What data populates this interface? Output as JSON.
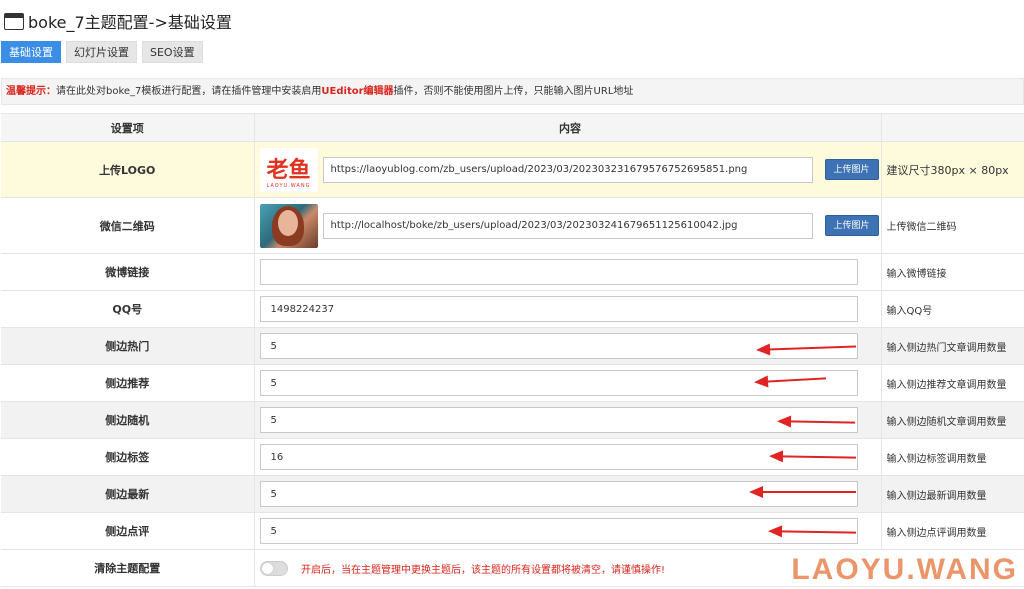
{
  "header": {
    "title": "boke_7主题配置->基础设置",
    "window_icon": "window-icon"
  },
  "tabs": [
    {
      "label": "基础设置",
      "active": true
    },
    {
      "label": "幻灯片设置",
      "active": false
    },
    {
      "label": "SEO设置",
      "active": false
    }
  ],
  "tip": {
    "label": "温馨提示：",
    "text_before": "请在此处对boke_7模板进行配置，请在插件管理中安装启用",
    "strong": "UEditor编辑器",
    "text_after": "插件，否则不能使用图片上传，只能输入图片URL地址"
  },
  "table": {
    "headers": [
      "设置项",
      "内容",
      ""
    ],
    "upload_button_label": "上传图片",
    "rows": {
      "logo": {
        "label": "上传LOGO",
        "value": "https://laoyublog.com/zb_users/upload/2023/03/202303231679576752695851.png",
        "desc": "建议尺寸380px × 80px",
        "thumb_text": "老鱼",
        "thumb_sub": "LAOYU.WANG"
      },
      "wechat": {
        "label": "微信二维码",
        "value": "http://localhost/boke/zb_users/upload/2023/03/202303241679651125610042.jpg",
        "desc": "上传微信二维码"
      },
      "weibo": {
        "label": "微博链接",
        "value": "",
        "desc": "输入微博链接"
      },
      "qq": {
        "label": "QQ号",
        "value": "1498224237",
        "desc": "输入QQ号"
      },
      "hot": {
        "label": "侧边热门",
        "value": "5",
        "desc": "输入侧边热门文章调用数量"
      },
      "recommend": {
        "label": "侧边推荐",
        "value": "5",
        "desc": "输入侧边推荐文章调用数量"
      },
      "random": {
        "label": "侧边随机",
        "value": "5",
        "desc": "输入侧边随机文章调用数量"
      },
      "tags": {
        "label": "侧边标签",
        "value": "16",
        "desc": "输入侧边标签调用数量"
      },
      "latest": {
        "label": "侧边最新",
        "value": "5",
        "desc": "输入侧边最新调用数量"
      },
      "comments": {
        "label": "侧边点评",
        "value": "5",
        "desc": "输入侧边点评调用数量"
      },
      "clear": {
        "label": "清除主题配置",
        "toggle_on": false,
        "warning": "开启后，当在主题管理中更换主题后，该主题的所有设置都将被清空，请谨慎操作!"
      }
    }
  },
  "watermark": "LAOYU.WANG",
  "colors": {
    "accent": "#3a8ee6",
    "upload_button": "#3d73b4",
    "warning": "#d9251d",
    "highlight_row": "#fdfbdc",
    "arrow": "#e02424"
  }
}
